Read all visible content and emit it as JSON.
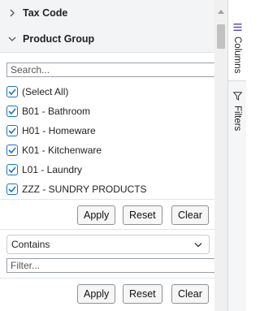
{
  "groups": {
    "tax_code": {
      "label": "Tax Code",
      "expanded": false
    },
    "product_group": {
      "label": "Product Group",
      "expanded": true
    }
  },
  "set_filter": {
    "search_placeholder": "Search...",
    "items": [
      {
        "label": "(Select All)",
        "checked": true
      },
      {
        "label": "B01 - Bathroom",
        "checked": true
      },
      {
        "label": "H01 - Homeware",
        "checked": true
      },
      {
        "label": "K01 - Kitchenware",
        "checked": true
      },
      {
        "label": "L01 - Laundry",
        "checked": true
      },
      {
        "label": "ZZZ - SUNDRY PRODUCTS",
        "checked": true
      }
    ],
    "buttons": {
      "apply": "Apply",
      "reset": "Reset",
      "clear": "Clear"
    }
  },
  "text_filter": {
    "operator": "Contains",
    "placeholder": "Filter...",
    "buttons": {
      "apply": "Apply",
      "reset": "Reset",
      "clear": "Clear"
    }
  },
  "side_bar": {
    "columns_label": "Columns",
    "filters_label": "Filters"
  },
  "colors": {
    "accent": "#1a73c8",
    "header_bg": "#f3f4f5"
  }
}
